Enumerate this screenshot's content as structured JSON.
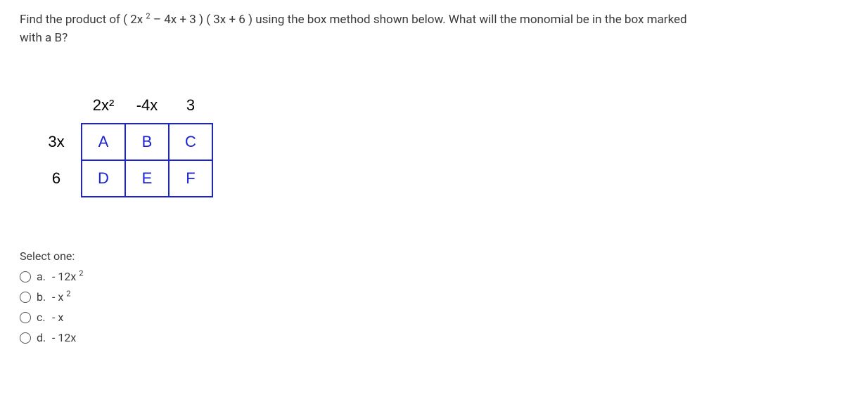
{
  "question": {
    "line1_prefix": "Find the product of ( 2x ",
    "line1_sup": "2",
    "line1_suffix": " – 4x + 3 ) ( 3x + 6 ) using the box method shown below. What will the monomial be in the box marked",
    "line2": "with a B?"
  },
  "box": {
    "col_headers": [
      "2x²",
      "-4x",
      "3"
    ],
    "row_labels": [
      "3x",
      "6"
    ],
    "cells": [
      [
        "A",
        "B",
        "C"
      ],
      [
        "D",
        "E",
        "F"
      ]
    ]
  },
  "select_label": "Select one:",
  "options": [
    {
      "letter": "a.",
      "prefix": " - 12x ",
      "sup": "2",
      "suffix": ""
    },
    {
      "letter": "b.",
      "prefix": " - x ",
      "sup": "2",
      "suffix": ""
    },
    {
      "letter": "c.",
      "prefix": " - x",
      "sup": "",
      "suffix": ""
    },
    {
      "letter": "d.",
      "prefix": " - 12x",
      "sup": "",
      "suffix": ""
    }
  ]
}
